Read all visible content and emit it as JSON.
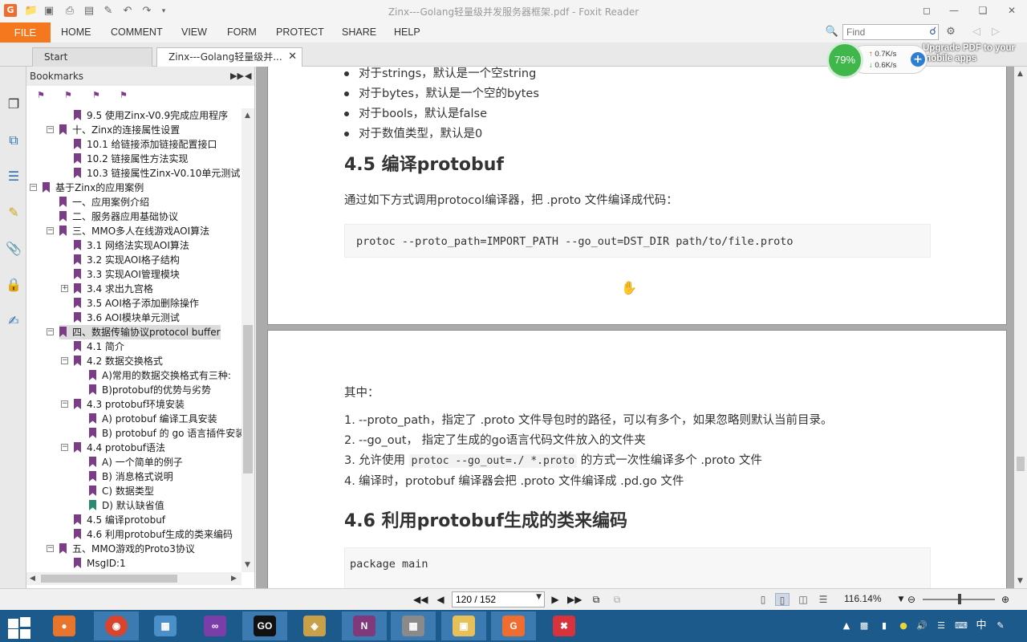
{
  "window": {
    "title": "Zinx---Golang轻量级并发服务器框架.pdf - Foxit Reader",
    "app_icon": "foxit-logo-icon"
  },
  "ribbon": {
    "file_label": "FILE",
    "tabs": [
      "HOME",
      "COMMENT",
      "VIEW",
      "FORM",
      "PROTECT",
      "SHARE",
      "HELP"
    ],
    "find_placeholder": "Find"
  },
  "doc_tabs": [
    {
      "label": "Start"
    },
    {
      "label": "Zinx---Golang轻量级并..."
    }
  ],
  "bookmarks": {
    "title": "Bookmarks",
    "items": [
      {
        "label": "9.5 使用Zinx-V0.9完成应用程序",
        "level": 3,
        "expander": ""
      },
      {
        "label": "十、Zinx的连接属性设置",
        "level": 2,
        "expander": "−"
      },
      {
        "label": "10.1 给链接添加链接配置接口",
        "level": 3,
        "expander": ""
      },
      {
        "label": "10.2 链接属性方法实现",
        "level": 3,
        "expander": ""
      },
      {
        "label": "10.3 链接属性Zinx-V0.10单元测试",
        "level": 3,
        "expander": ""
      },
      {
        "label": "基于Zinx的应用案例",
        "level": 1,
        "expander": "−"
      },
      {
        "label": "一、应用案例介绍",
        "level": 2,
        "expander": ""
      },
      {
        "label": "二、服务器应用基础协议",
        "level": 2,
        "expander": ""
      },
      {
        "label": "三、MMO多人在线游戏AOI算法",
        "level": 2,
        "expander": "−"
      },
      {
        "label": "3.1 网络法实现AOI算法",
        "level": 3,
        "expander": ""
      },
      {
        "label": "3.2 实现AOI格子结构",
        "level": 3,
        "expander": ""
      },
      {
        "label": "3.3 实现AOI管理模块",
        "level": 3,
        "expander": ""
      },
      {
        "label": "3.4 求出九宫格",
        "level": 3,
        "expander": "+"
      },
      {
        "label": "3.5 AOI格子添加删除操作",
        "level": 3,
        "expander": ""
      },
      {
        "label": "3.6 AOI模块单元测试",
        "level": 3,
        "expander": ""
      },
      {
        "label": "四、数据传输协议protocol buffer",
        "level": 2,
        "expander": "−",
        "selected": true
      },
      {
        "label": "4.1 简介",
        "level": 3,
        "expander": ""
      },
      {
        "label": "4.2 数据交换格式",
        "level": 3,
        "expander": "−"
      },
      {
        "label": "A)常用的数据交换格式有三种:",
        "level": 4,
        "expander": ""
      },
      {
        "label": "B)protobuf的优势与劣势",
        "level": 4,
        "expander": ""
      },
      {
        "label": "4.3 protobuf环境安装",
        "level": 3,
        "expander": "−"
      },
      {
        "label": "A) protobuf 编译工具安装",
        "level": 4,
        "expander": ""
      },
      {
        "label": "B) protobuf 的 go 语言插件安装",
        "level": 4,
        "expander": ""
      },
      {
        "label": "4.4 protobuf语法",
        "level": 3,
        "expander": "−"
      },
      {
        "label": "A) 一个简单的例子",
        "level": 4,
        "expander": ""
      },
      {
        "label": "B) 消息格式说明",
        "level": 4,
        "expander": ""
      },
      {
        "label": "C) 数据类型",
        "level": 4,
        "expander": ""
      },
      {
        "label": "D) 默认缺省值",
        "level": 4,
        "expander": "",
        "teal": true
      },
      {
        "label": "4.5 编译protobuf",
        "level": 3,
        "expander": ""
      },
      {
        "label": "4.6 利用protobuf生成的类来编码",
        "level": 3,
        "expander": ""
      },
      {
        "label": "五、MMO游戏的Proto3协议",
        "level": 2,
        "expander": "−"
      },
      {
        "label": "MsgID:1",
        "level": 3,
        "expander": ""
      }
    ]
  },
  "document": {
    "bullets": [
      "对于strings，默认是一个空string",
      "对于bytes，默认是一个空的bytes",
      "对于bools，默认是false",
      "对于数值类型，默认是0"
    ],
    "heading_45": "4.5 编译protobuf",
    "para_45": "通过如下方式调用protocol编译器，把 .proto 文件编译成代码：",
    "code_45": "protoc --proto_path=IMPORT_PATH --go_out=DST_DIR path/to/file.proto",
    "among": "其中：",
    "olist": [
      {
        "num": "1.",
        "text": "--proto_path，指定了 .proto 文件导包时的路径，可以有多个，如果忽略则默认当前目录。"
      },
      {
        "num": "2.",
        "text": "--go_out， 指定了生成的go语言代码文件放入的文件夹"
      },
      {
        "num": "3.",
        "pre": "允许使用 ",
        "code": "protoc --go_out=./ *.proto",
        "post": " 的方式一次性编译多个 .proto 文件"
      },
      {
        "num": "4.",
        "text": "编译时，protobuf 编译器会把 .proto 文件编译成 .pd.go 文件"
      }
    ],
    "heading_46": "4.6 利用protobuf生成的类来编码",
    "code_46": "package main"
  },
  "net_widget": {
    "percent": "79%",
    "up": "0.7K/s",
    "down": "0.6K/s",
    "upgrade_text": "Upgrade PDF to your mobile apps"
  },
  "statusbar": {
    "page_value": "120 / 152",
    "zoom": "116.14%"
  },
  "colors": {
    "file_tab": "#f5781e",
    "bookmark_flag": "#7a3d86",
    "taskbar": "#1c5a8c",
    "net_circle": "#3fb74a"
  }
}
